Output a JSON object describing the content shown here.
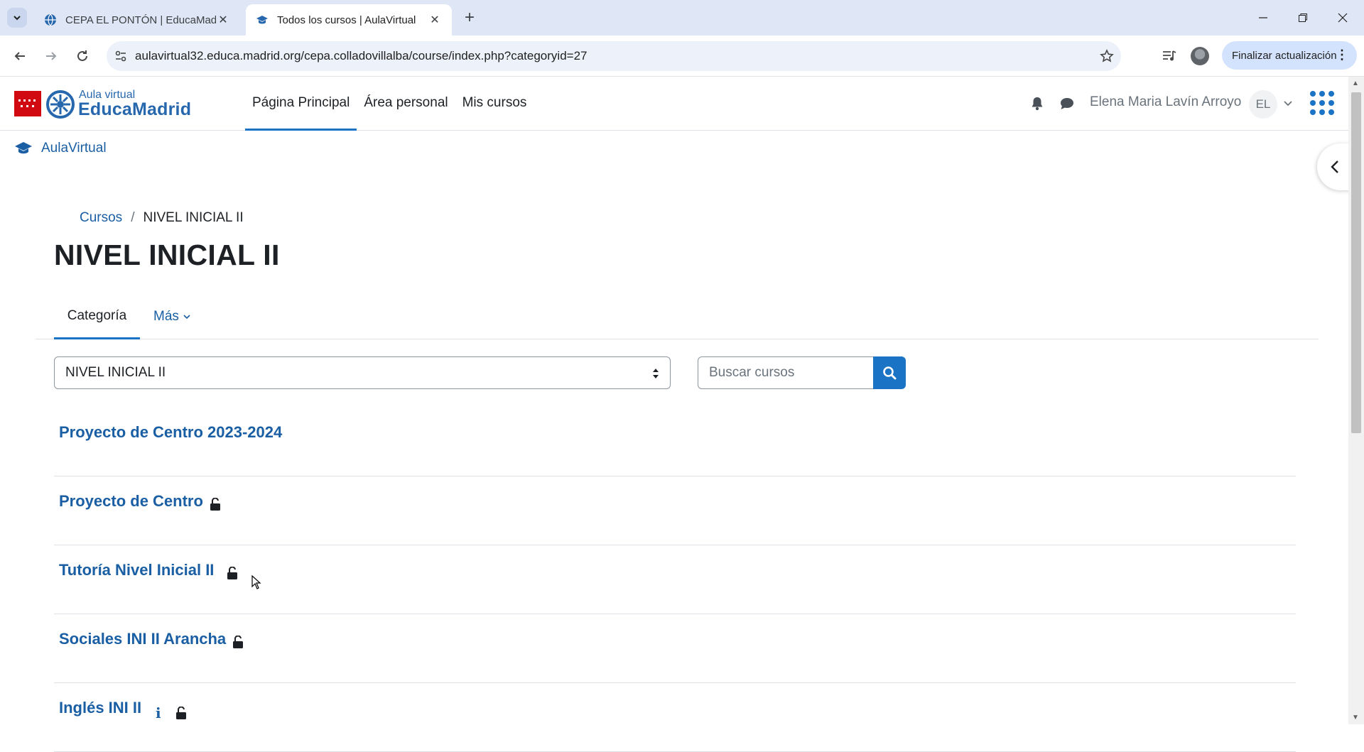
{
  "browser": {
    "tabs": [
      {
        "title": "CEPA EL PONTÓN | EducaMadrid",
        "active": false
      },
      {
        "title": "Todos los cursos | AulaVirtual",
        "active": true
      }
    ],
    "url": "aulavirtual32.educa.madrid.org/cepa.colladovillalba/course/index.php?categoryid=27",
    "update_button": "Finalizar actualización"
  },
  "header": {
    "logo_small": "Aula virtual",
    "logo_big": "EducaMadrid",
    "nav": [
      {
        "label": "Página Principal",
        "active": true
      },
      {
        "label": "Área personal",
        "active": false
      },
      {
        "label": "Mis cursos",
        "active": false
      }
    ],
    "user_name": "Elena Maria Lavín Arroyo",
    "avatar_initials": "EL"
  },
  "site_link": "AulaVirtual",
  "breadcrumb": {
    "parent": "Cursos",
    "separator": "/",
    "current": "NIVEL INICIAL II"
  },
  "page_title": "NIVEL INICIAL II",
  "secondary_nav": {
    "category": "Categoría",
    "more": "Más"
  },
  "category_select": {
    "selected": "NIVEL INICIAL II"
  },
  "search": {
    "placeholder": "Buscar cursos"
  },
  "courses": [
    {
      "name": "Proyecto de Centro 2023-2024",
      "lock": false,
      "info": ""
    },
    {
      "name": "Proyecto de Centro",
      "lock": true,
      "info": ""
    },
    {
      "name": "Tutoría Nivel Inicial II",
      "lock": true,
      "info": ""
    },
    {
      "name": "Sociales INI II Arancha",
      "lock": true,
      "info": ""
    },
    {
      "name": "Inglés INI II",
      "lock": true,
      "info": "i"
    }
  ],
  "colors": {
    "accent": "#1a73c4",
    "link": "#1a5ea3",
    "brand_red": "#d10a11"
  }
}
